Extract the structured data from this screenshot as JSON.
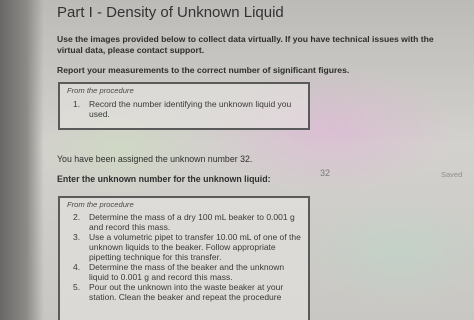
{
  "heading": "Part I - Density of Unknown Liquid",
  "instructions": "Use the images provided below to collect data virtually. If you have technical issues with the virtual data, please contact support.",
  "sigfig_note": "Report your measurements to the correct number of significant figures.",
  "procedure_box_1": {
    "title": "From the procedure",
    "steps": [
      {
        "num": "1.",
        "text": "Record the number identifying the unknown liquid you used."
      }
    ]
  },
  "assigned_text": "You have been assigned the unknown number 32.",
  "enter_label": "Enter the unknown number for the unknown liquid:",
  "answer": {
    "value": "32"
  },
  "saved_status": "Saved",
  "procedure_box_2": {
    "title": "From the procedure",
    "steps": [
      {
        "num": "2.",
        "text": "Determine the mass of a dry 100 mL beaker to 0.001 g and record this mass."
      },
      {
        "num": "3.",
        "text": "Use a volumetric pipet to transfer 10.00 mL of one of the unknown liquids to the beaker. Follow appropriate pipetting technique for this transfer."
      },
      {
        "num": "4.",
        "text": "Determine the mass of the beaker and the unknown liquid to 0.001 g and record this mass."
      },
      {
        "num": "5.",
        "text": "Pour out the unknown into the waste beaker at your station. Clean the beaker and repeat the procedure"
      }
    ]
  }
}
